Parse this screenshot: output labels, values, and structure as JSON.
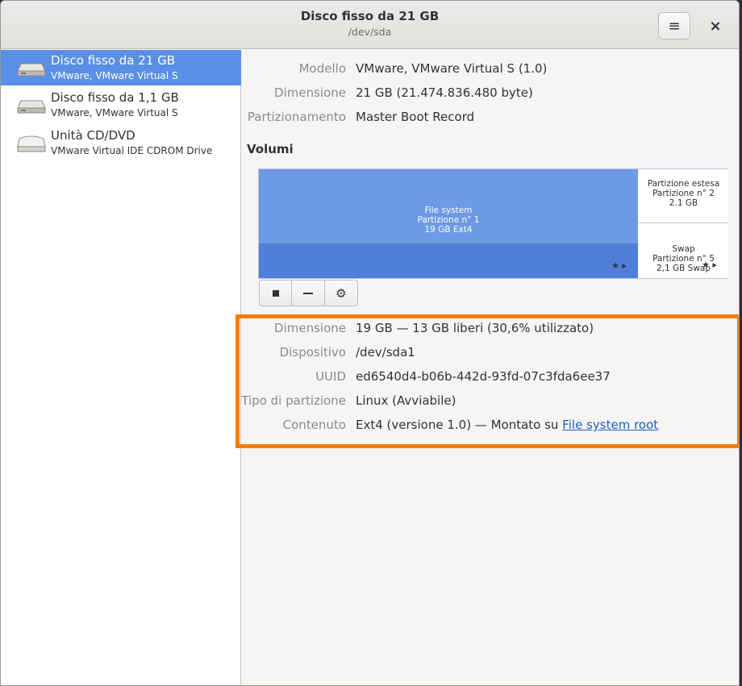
{
  "header": {
    "title": "Disco fisso da 21 GB",
    "subtitle": "/dev/sda",
    "menu_icon": "hamburger-menu-icon",
    "close_icon": "close-icon"
  },
  "sidebar": {
    "drives": [
      {
        "name": "Disco fisso da 21 GB",
        "desc": "VMware, VMware Virtual S",
        "icon": "hard-disk-icon"
      },
      {
        "name": "Disco fisso da 1,1 GB",
        "desc": "VMware, VMware Virtual S",
        "icon": "hard-disk-icon"
      },
      {
        "name": "Unità CD/DVD",
        "desc": "VMware Virtual IDE CDROM Drive",
        "icon": "optical-drive-icon"
      }
    ]
  },
  "disk_info": {
    "model_label": "Modello",
    "model_value": "VMware, VMware Virtual S (1.0)",
    "size_label": "Dimensione",
    "size_value": "21 GB (21.474.836.480 byte)",
    "partitioning_label": "Partizionamento",
    "partitioning_value": "Master Boot Record"
  },
  "volumes": {
    "heading": "Volumi",
    "main": {
      "line1": "File system",
      "line2": "Partizione n° 1",
      "line3": "19 GB Ext4"
    },
    "extended": {
      "line1": "Partizione estesa",
      "line2": "Partizione n° 2",
      "line3": "2.1 GB"
    },
    "swap": {
      "line1": "Swap",
      "line2": "Partizione n° 5",
      "line3": "2,1 GB Swap"
    }
  },
  "toolbar": {
    "stop_icon": "stop-icon",
    "minus_icon": "remove-icon",
    "settings_icon": "gears-icon"
  },
  "partition_details": {
    "size_label": "Dimensione",
    "size_value": "19 GB — 13 GB liberi (30,6% utilizzato)",
    "device_label": "Dispositivo",
    "device_value": "/dev/sda1",
    "uuid_label": "UUID",
    "uuid_value": "ed6540d4-b06b-442d-93fd-07c3fda6ee37",
    "type_label": "Tipo di partizione",
    "type_value": "Linux (Avviabile)",
    "content_label": "Contenuto",
    "content_value_prefix": "Ext4 (versione 1.0) — Montato su ",
    "content_link": "File system root"
  },
  "colors": {
    "selection": "#5a8fe6",
    "volume_fill": "#6e9ae4",
    "highlight": "#f57c00"
  }
}
